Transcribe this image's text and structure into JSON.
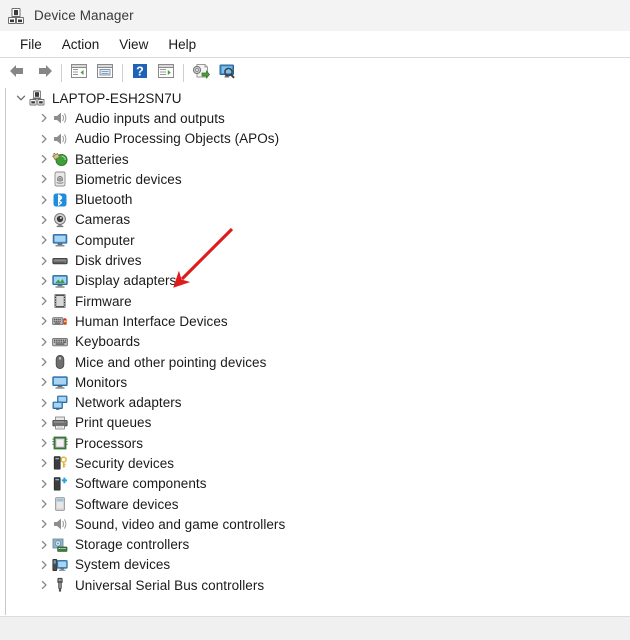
{
  "window": {
    "title": "Device Manager",
    "icon": "device-manager-icon"
  },
  "menubar": {
    "items": [
      {
        "label": "File",
        "name": "menu-file"
      },
      {
        "label": "Action",
        "name": "menu-action"
      },
      {
        "label": "View",
        "name": "menu-view"
      },
      {
        "label": "Help",
        "name": "menu-help"
      }
    ]
  },
  "toolbar": {
    "buttons": [
      {
        "icon": "back-arrow-icon",
        "name": "toolbar-back"
      },
      {
        "icon": "forward-arrow-icon",
        "name": "toolbar-forward"
      },
      {
        "icon": "separator",
        "name": "toolbar-separator-1"
      },
      {
        "icon": "show-hide-console-tree-icon",
        "name": "toolbar-console-tree"
      },
      {
        "icon": "properties-icon",
        "name": "toolbar-properties"
      },
      {
        "icon": "separator",
        "name": "toolbar-separator-2"
      },
      {
        "icon": "help-icon",
        "name": "toolbar-help"
      },
      {
        "icon": "show-hide-action-pane-icon",
        "name": "toolbar-action-pane"
      },
      {
        "icon": "separator",
        "name": "toolbar-separator-3"
      },
      {
        "icon": "update-driver-icon",
        "name": "toolbar-update-driver"
      },
      {
        "icon": "scan-hardware-changes-icon",
        "name": "toolbar-scan-hardware"
      }
    ]
  },
  "tree": {
    "root": {
      "label": "LAPTOP-ESH2SN7U",
      "icon": "computer-root-icon",
      "expander": "chevron-down-icon",
      "expanded": true
    },
    "nodes": [
      {
        "label": "Audio inputs and outputs",
        "icon": "speaker-icon",
        "expander": "chevron-right-icon"
      },
      {
        "label": "Audio Processing Objects (APOs)",
        "icon": "speaker-icon",
        "expander": "chevron-right-icon"
      },
      {
        "label": "Batteries",
        "icon": "battery-icon",
        "expander": "chevron-right-icon"
      },
      {
        "label": "Biometric devices",
        "icon": "fingerprint-icon",
        "expander": "chevron-right-icon"
      },
      {
        "label": "Bluetooth",
        "icon": "bluetooth-icon",
        "expander": "chevron-right-icon"
      },
      {
        "label": "Cameras",
        "icon": "camera-icon",
        "expander": "chevron-right-icon"
      },
      {
        "label": "Computer",
        "icon": "computer-icon",
        "expander": "chevron-right-icon"
      },
      {
        "label": "Disk drives",
        "icon": "disk-drive-icon",
        "expander": "chevron-right-icon"
      },
      {
        "label": "Display adapters",
        "icon": "display-adapter-icon",
        "expander": "chevron-right-icon"
      },
      {
        "label": "Firmware",
        "icon": "firmware-icon",
        "expander": "chevron-right-icon"
      },
      {
        "label": "Human Interface Devices",
        "icon": "hid-icon",
        "expander": "chevron-right-icon"
      },
      {
        "label": "Keyboards",
        "icon": "keyboard-icon",
        "expander": "chevron-right-icon"
      },
      {
        "label": "Mice and other pointing devices",
        "icon": "mouse-icon",
        "expander": "chevron-right-icon"
      },
      {
        "label": "Monitors",
        "icon": "monitor-icon",
        "expander": "chevron-right-icon"
      },
      {
        "label": "Network adapters",
        "icon": "network-adapter-icon",
        "expander": "chevron-right-icon"
      },
      {
        "label": "Print queues",
        "icon": "printer-icon",
        "expander": "chevron-right-icon"
      },
      {
        "label": "Processors",
        "icon": "processor-icon",
        "expander": "chevron-right-icon"
      },
      {
        "label": "Security devices",
        "icon": "security-key-icon",
        "expander": "chevron-right-icon"
      },
      {
        "label": "Software components",
        "icon": "software-component-icon",
        "expander": "chevron-right-icon"
      },
      {
        "label": "Software devices",
        "icon": "software-device-icon",
        "expander": "chevron-right-icon"
      },
      {
        "label": "Sound, video and game controllers",
        "icon": "speaker-icon",
        "expander": "chevron-right-icon"
      },
      {
        "label": "Storage controllers",
        "icon": "storage-controller-icon",
        "expander": "chevron-right-icon"
      },
      {
        "label": "System devices",
        "icon": "system-device-icon",
        "expander": "chevron-right-icon"
      },
      {
        "label": "Universal Serial Bus controllers",
        "icon": "usb-icon",
        "expander": "chevron-right-icon"
      }
    ]
  },
  "annotation": {
    "type": "arrow",
    "color": "#e01b1b",
    "points_at": "Display adapters"
  }
}
